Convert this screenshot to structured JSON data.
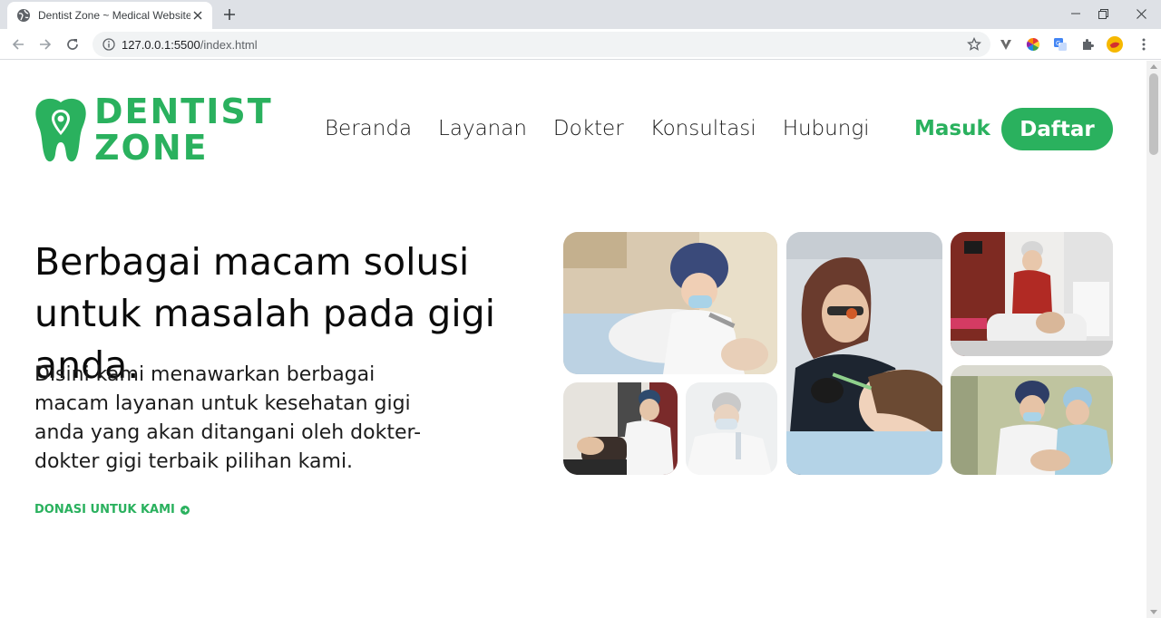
{
  "browser": {
    "tab_title": "Dentist Zone ~ Medical Website",
    "url_host": "127.0.0.1:5500",
    "url_path": "/index.html",
    "favicon": "globe-icon",
    "extensions": [
      "vivaldi-v-icon",
      "color-wheel-icon",
      "translate-icon",
      "puzzle-extensions-icon",
      "profile-avatar-icon",
      "kebab-menu-icon"
    ]
  },
  "header": {
    "logo_line1": "DENTIST",
    "logo_line2": "ZONE",
    "logo_icon": "tooth-pin-icon",
    "nav": [
      "Beranda",
      "Layanan",
      "Dokter",
      "Konsultasi",
      "Hubungi"
    ],
    "login_label": "Masuk",
    "register_label": "Daftar"
  },
  "hero": {
    "title": "Berbagai macam solusi untuk masalah pada gigi anda.",
    "description": "Disini kami menawarkan berbagai macam layanan untuk kesehatan gigi anda yang akan ditangani oleh dokter-dokter gigi terbaik pilihan kami.",
    "cta_label": "DONASI UNTUK KAMI",
    "cta_icon": "arrow-circle-right-icon"
  },
  "gallery": {
    "photos": [
      "dentist-treating-patient-photo",
      "dentist-with-loupe-photo",
      "dentist-in-mask-photo",
      "dentist-with-headlamp-photo",
      "dental-clinic-room-photo",
      "two-dentists-at-work-photo"
    ]
  },
  "colors": {
    "brand_green": "#2ab15e",
    "text_dark": "#0b0b0b"
  }
}
